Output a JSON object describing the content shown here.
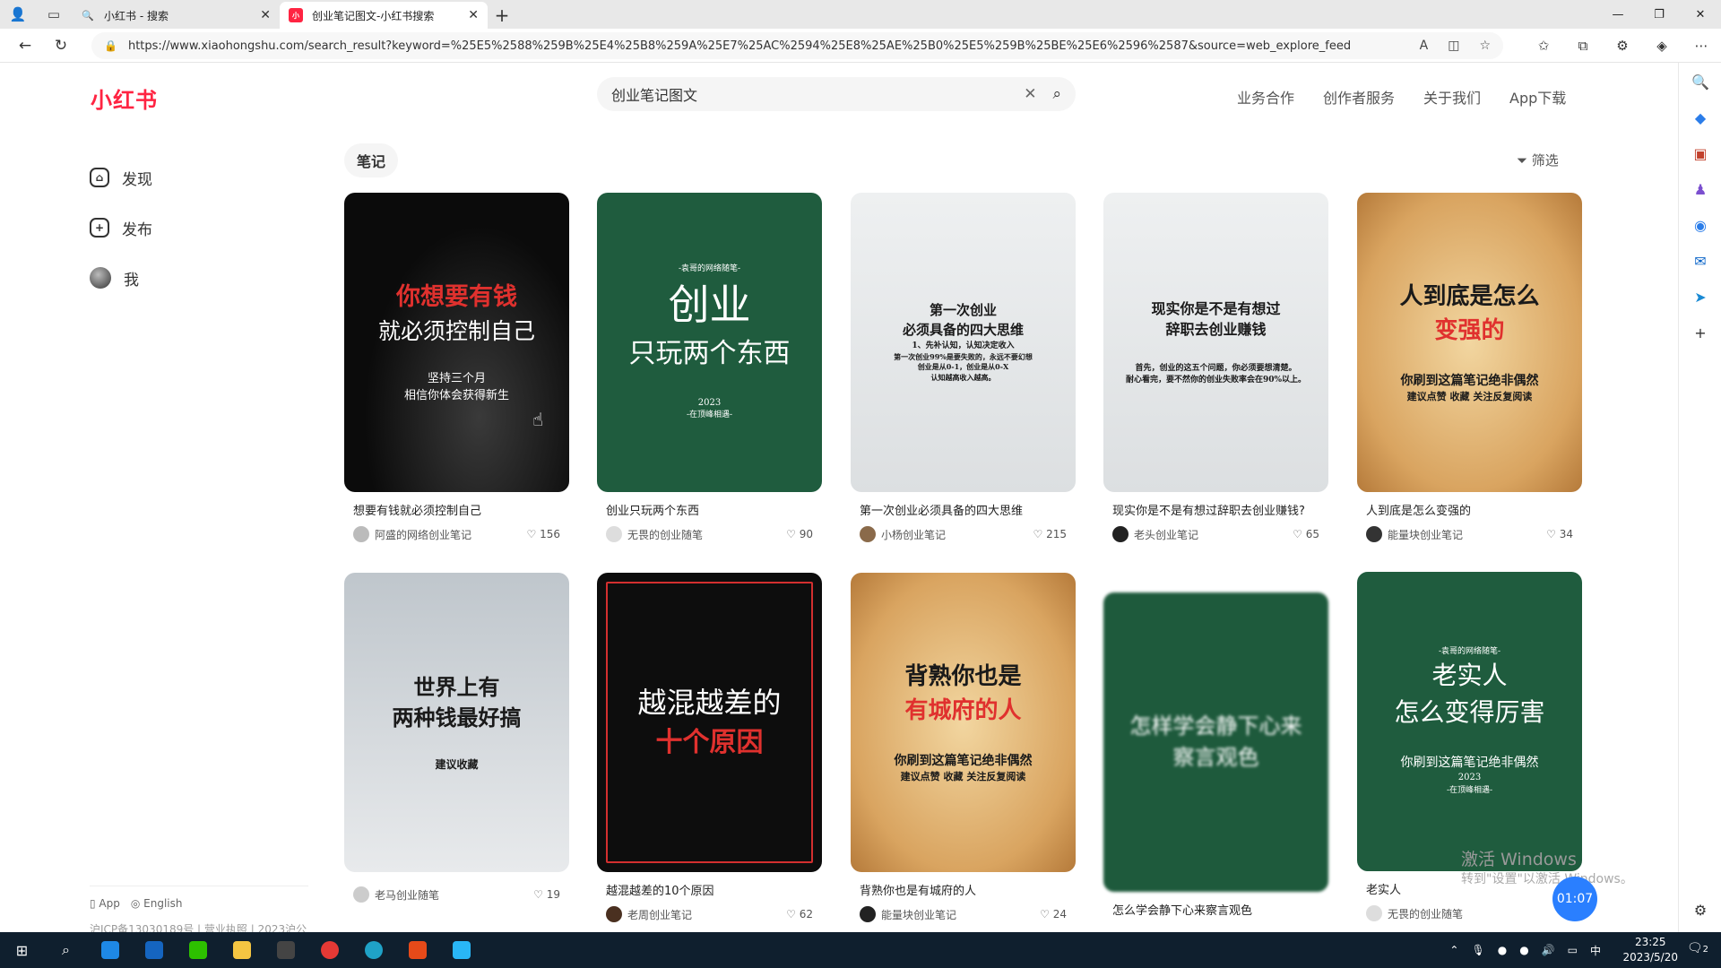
{
  "tabs": [
    {
      "title": "小红书 - 搜索",
      "active": false
    },
    {
      "title": "创业笔记图文-小红书搜索",
      "active": true
    }
  ],
  "address": {
    "url": "https://www.xiaohongshu.com/search_result?keyword=%25E5%2588%259B%25E4%25B8%259A%25E7%25AC%2594%25E8%25AE%25B0%25E5%259B%25BE%25E6%2596%2587&source=web_explore_feed"
  },
  "site": {
    "logo": "小红书",
    "search_value": "创业笔记图文",
    "nav": [
      "业务合作",
      "创作者服务",
      "关于我们",
      "App下载"
    ]
  },
  "sidebar": {
    "items": [
      {
        "label": "发现",
        "icon": "home-icon"
      },
      {
        "label": "发布",
        "icon": "plus-icon"
      },
      {
        "label": "我",
        "icon": "avatar"
      }
    ],
    "footer": {
      "app": "App",
      "lang": "English"
    },
    "icp": "沪ICP备13030189号 | 营业执照 | 2023沪公"
  },
  "filter_chip": "笔记",
  "filter_label": "筛选",
  "cards": [
    {
      "title": "想要有钱就必须控制自己",
      "author": "阿盛的网络创业笔记",
      "likes": "156",
      "cover": {
        "style": "c-black",
        "lines": [
          {
            "text": "你想要有钱",
            "cls": "big-red",
            "size": 27
          },
          {
            "text": "就必须控制自己",
            "cls": "white",
            "size": 25
          },
          {
            "text": "坚持三个月",
            "cls": "white",
            "size": 13
          },
          {
            "text": "相信你体会获得新生",
            "cls": "white",
            "size": 13
          }
        ]
      }
    },
    {
      "title": "创业只玩两个东西",
      "author": "无畏的创业随笔",
      "likes": "90",
      "cover": {
        "style": "c-green",
        "lines": [
          {
            "text": "-袁哥的网络随笔-",
            "cls": "white",
            "size": 9
          },
          {
            "text": "创业",
            "cls": "white",
            "size": 46
          },
          {
            "text": "只玩两个东西",
            "cls": "white",
            "size": 30
          },
          {
            "text": "2023",
            "cls": "white",
            "size": 10
          },
          {
            "text": "-在顶峰相遇-",
            "cls": "white",
            "size": 9
          }
        ]
      }
    },
    {
      "title": "第一次创业必须具备的四大思维",
      "author": "小杨创业笔记",
      "likes": "215",
      "cover": {
        "style": "c-light",
        "lines": [
          {
            "text": "第一次创业",
            "cls": "dark",
            "size": 15
          },
          {
            "text": "必须具备的四大思维",
            "cls": "dark",
            "size": 15
          },
          {
            "text": "1、先补认知，认知决定收入",
            "cls": "dark",
            "size": 9
          },
          {
            "text": "第一次创业99%是要失败的，永远不要幻想",
            "cls": "dark",
            "size": 8
          },
          {
            "text": "创业是从0-1，创业是从0-X",
            "cls": "dark",
            "size": 8
          },
          {
            "text": "认知越高收入越高。",
            "cls": "dark",
            "size": 8
          }
        ]
      }
    },
    {
      "title": "现实你是不是有想过辞职去创业赚钱?",
      "author": "老头创业笔记",
      "likes": "65",
      "cover": {
        "style": "c-light",
        "lines": [
          {
            "text": "现实你是不是有想过",
            "cls": "dark",
            "size": 16
          },
          {
            "text": "辞职去创业赚钱",
            "cls": "dark",
            "size": 16
          },
          {
            "text": "首先，创业的这五个问题，你必须要想清楚。",
            "cls": "dark",
            "size": 9
          },
          {
            "text": "耐心看完，要不然你的创业失败率会在90%以上。",
            "cls": "dark",
            "size": 9
          }
        ]
      }
    },
    {
      "title": "人到底是怎么变强的",
      "author": "能量块创业笔记",
      "likes": "34",
      "cover": {
        "style": "c-paper",
        "lines": [
          {
            "text": "人到底是怎么",
            "cls": "dark",
            "size": 26
          },
          {
            "text": "变强的",
            "cls": "big-red",
            "size": 26
          },
          {
            "text": "你刷到这篇笔记绝非偶然",
            "cls": "dark",
            "size": 14
          },
          {
            "text": "建议点赞 收藏 关注反复阅读",
            "cls": "dark",
            "size": 11
          }
        ]
      }
    },
    {
      "title": "",
      "author": "老马创业随笔",
      "likes": "19",
      "cover": {
        "style": "c-grey",
        "lines": [
          {
            "text": "世界上有",
            "cls": "dark",
            "size": 24
          },
          {
            "text": "两种钱最好搞",
            "cls": "dark",
            "size": 24
          },
          {
            "text": "建议收藏",
            "cls": "dark",
            "size": 12
          }
        ]
      }
    },
    {
      "title": "越混越差的10个原因",
      "author": "老周创业笔记",
      "likes": "62",
      "cover": {
        "style": "c-frame",
        "lines": [
          {
            "text": "越混越差的",
            "cls": "white",
            "size": 32
          },
          {
            "text": "十个原因",
            "cls": "big-red",
            "size": 30
          }
        ]
      }
    },
    {
      "title": "背熟你也是有城府的人",
      "author": "能量块创业笔记",
      "likes": "24",
      "cover": {
        "style": "c-paper",
        "lines": [
          {
            "text": "背熟你也是",
            "cls": "dark",
            "size": 26
          },
          {
            "text": "有城府的人",
            "cls": "big-red",
            "size": 26
          },
          {
            "text": "你刷到这篇笔记绝非偶然",
            "cls": "dark",
            "size": 14
          },
          {
            "text": "建议点赞 收藏 关注反复阅读",
            "cls": "dark",
            "size": 11
          }
        ]
      }
    },
    {
      "title": "怎么学会静下心来察言观色",
      "author": "",
      "likes": "",
      "cover": {
        "style": "c-blur",
        "lines": [
          {
            "text": "怎样学会静下心来",
            "cls": "white",
            "size": 24
          },
          {
            "text": "察言观色",
            "cls": "white",
            "size": 24
          }
        ]
      }
    },
    {
      "title": "老实人",
      "author": "无畏的创业随笔",
      "likes": "",
      "cover": {
        "style": "c-green",
        "lines": [
          {
            "text": "-袁哥的网络随笔-",
            "cls": "white",
            "size": 9
          },
          {
            "text": "老实人",
            "cls": "white",
            "size": 28
          },
          {
            "text": "怎么变得厉害",
            "cls": "white",
            "size": 28
          },
          {
            "text": "你刷到这篇笔记绝非偶然",
            "cls": "white",
            "size": 14
          },
          {
            "text": "2023",
            "cls": "white",
            "size": 10
          },
          {
            "text": "-在顶峰相遇-",
            "cls": "white",
            "size": 9
          }
        ]
      }
    }
  ],
  "overlay": {
    "watermark": "激活 Windows",
    "watermark_sub": "转到\"设置\"以激活 Windows。",
    "timer": "01:07"
  },
  "taskbar": {
    "time": "23:25",
    "date": "2023/5/20",
    "ime": "中",
    "notifications": "2"
  }
}
